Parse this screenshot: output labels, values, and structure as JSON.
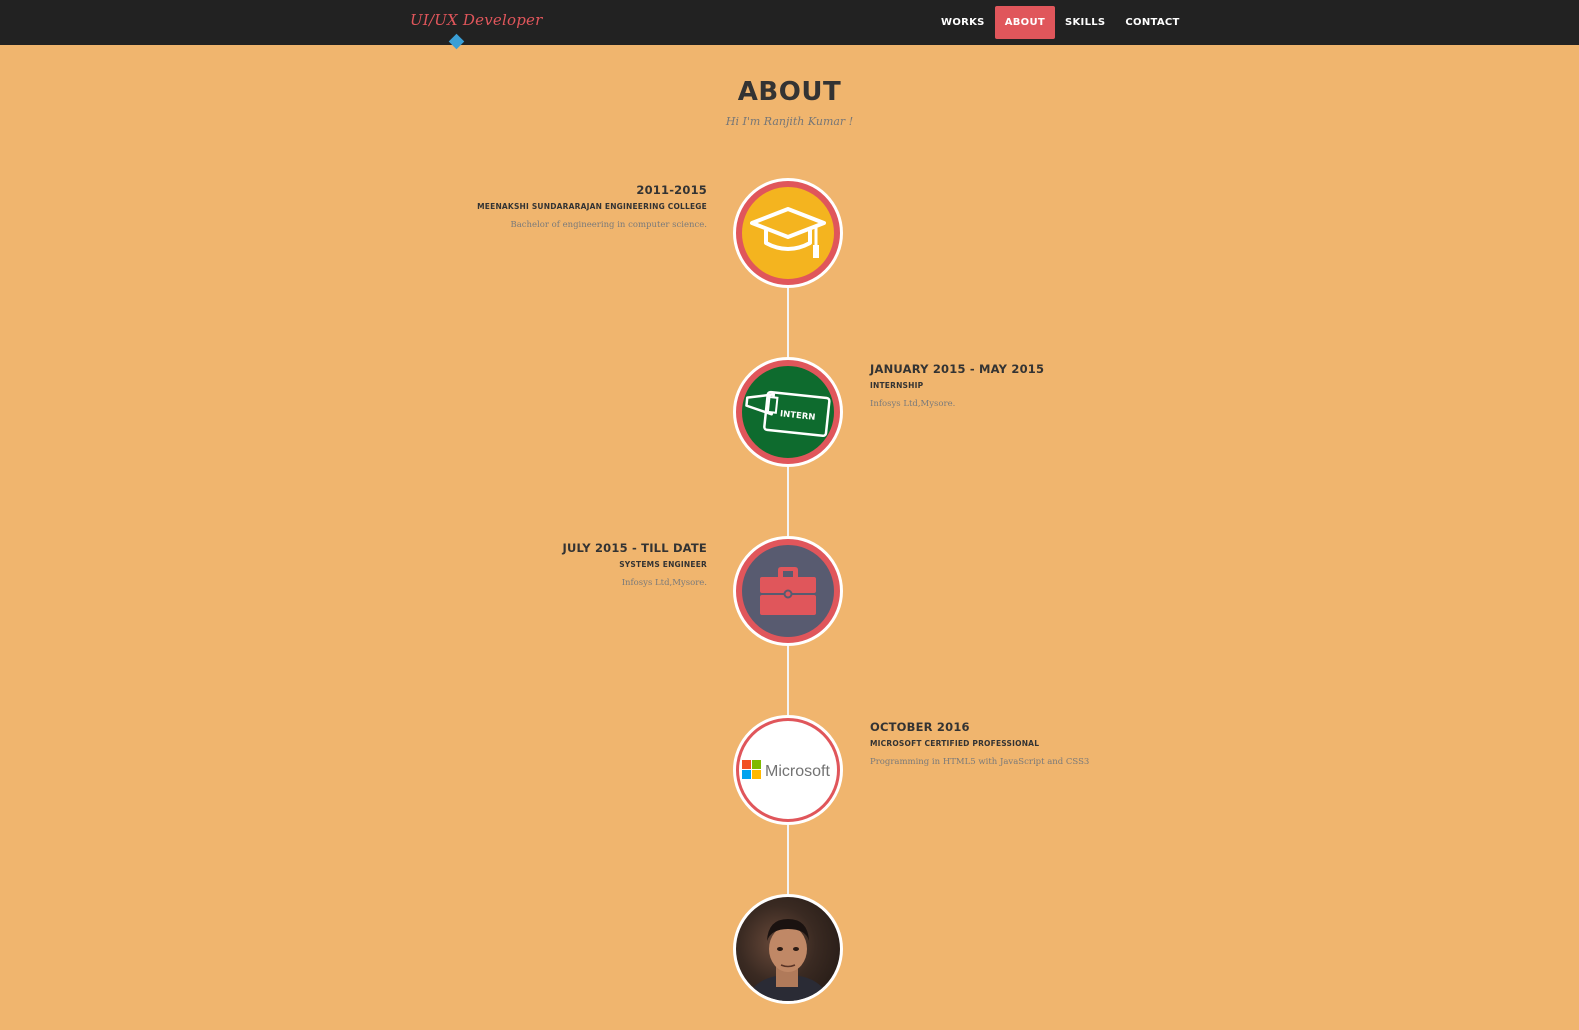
{
  "navbar": {
    "brand": "UI/UX Developer",
    "links": [
      {
        "label": "WORKS",
        "active": false
      },
      {
        "label": "ABOUT",
        "active": true
      },
      {
        "label": "SKILLS",
        "active": false
      },
      {
        "label": "CONTACT",
        "active": false
      }
    ]
  },
  "about": {
    "title": "ABOUT",
    "subtitle": "Hi I'm Ranjith Kumar !"
  },
  "timeline": [
    {
      "date": "2011-2015",
      "organization": "MEENAKSHI SUNDARARAJAN ENGINEERING COLLEGE",
      "description": "Bachelor of engineering in computer science.",
      "icon": "graduation-cap-icon",
      "circle_color": "#f4b41f"
    },
    {
      "date": "JANUARY 2015 - MAY 2015",
      "organization": "INTERNSHIP",
      "description": "Infosys Ltd,Mysore.",
      "icon": "intern-badge-icon",
      "badge_text": "INTERN",
      "circle_color": "#0e6b2e"
    },
    {
      "date": "JULY 2015 - TILL DATE",
      "organization": "SYSTEMS ENGINEER",
      "description": "Infosys Ltd,Mysore.",
      "icon": "briefcase-icon",
      "circle_color": "#585b70"
    },
    {
      "date": "OCTOBER 2016",
      "organization": "MICROSOFT CERTIFIED PROFESSIONAL",
      "description": "Programming in HTML5 with JavaScript and CSS3",
      "icon": "microsoft-logo",
      "logo_text": "Microsoft",
      "circle_color": "#ffffff"
    },
    {
      "icon": "profile-photo",
      "circle_color": "#3a2a22"
    }
  ],
  "colors": {
    "background": "#f0b56e",
    "navbar": "#222222",
    "accent": "#e0565b",
    "marker": "#3a9fd6"
  }
}
